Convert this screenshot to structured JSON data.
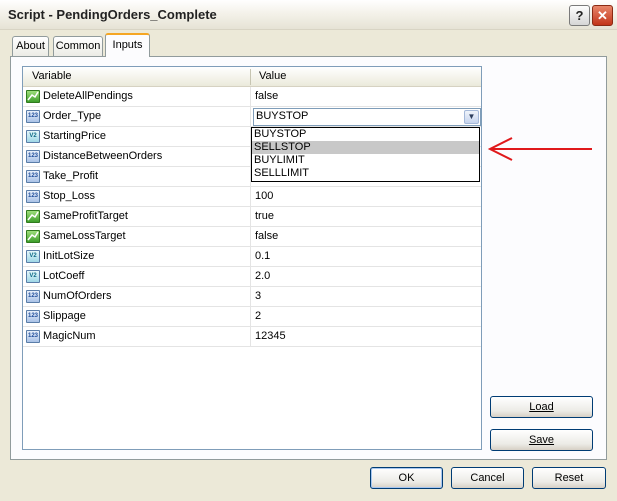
{
  "window": {
    "title": "Script - PendingOrders_Complete",
    "help_icon": "?",
    "close_icon": "✕"
  },
  "tabs": [
    {
      "label": "About",
      "active": false
    },
    {
      "label": "Common",
      "active": false
    },
    {
      "label": "Inputs",
      "active": true
    }
  ],
  "grid": {
    "headers": {
      "variable": "Variable",
      "value": "Value"
    },
    "rows": [
      {
        "name": "DeleteAllPendings",
        "value": "false",
        "type": "bool"
      },
      {
        "name": "Order_Type",
        "value": "BUYSTOP",
        "type": "int"
      },
      {
        "name": "StartingPrice",
        "value": "",
        "type": "double"
      },
      {
        "name": "DistanceBetweenOrders",
        "value": "",
        "type": "int"
      },
      {
        "name": "Take_Profit",
        "value": "",
        "type": "int"
      },
      {
        "name": "Stop_Loss",
        "value": "100",
        "type": "int"
      },
      {
        "name": "SameProfitTarget",
        "value": "true",
        "type": "bool"
      },
      {
        "name": "SameLossTarget",
        "value": "false",
        "type": "bool"
      },
      {
        "name": "InitLotSize",
        "value": "0.1",
        "type": "double"
      },
      {
        "name": "LotCoeff",
        "value": "2.0",
        "type": "double"
      },
      {
        "name": "NumOfOrders",
        "value": "3",
        "type": "int"
      },
      {
        "name": "Slippage",
        "value": "2",
        "type": "int"
      },
      {
        "name": "MagicNum",
        "value": "12345",
        "type": "int"
      }
    ]
  },
  "dropdown": {
    "options": [
      "BUYSTOP",
      "SELLSTOP",
      "BUYLIMIT",
      "SELLLIMIT"
    ],
    "highlighted": "SELLSTOP"
  },
  "icon_labels": {
    "int": "123",
    "double": "V2",
    "bool": ""
  },
  "buttons": {
    "load": "Load",
    "save": "Save",
    "ok": "OK",
    "cancel": "Cancel",
    "reset": "Reset"
  },
  "colors": {
    "arrow": "#e0191b",
    "accent_tab": "#f5a623"
  }
}
